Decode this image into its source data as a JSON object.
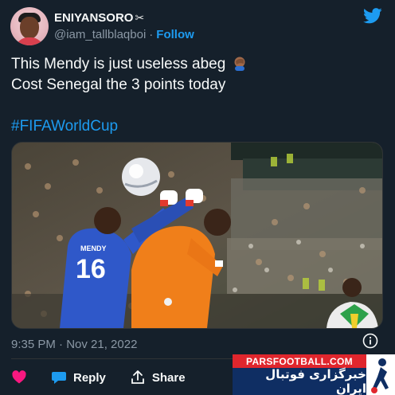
{
  "author": {
    "display_name": "ENIYANSORO",
    "handle": "@iam_tallblaqboi",
    "separator": "·",
    "follow_label": "Follow"
  },
  "tweet": {
    "line1": "This Mendy is just useless abeg",
    "line2": "Cost Senegal the 3 points today",
    "hashtag": "#FIFAWorldCup"
  },
  "media": {
    "jersey_name": "MENDY",
    "jersey_number": "16"
  },
  "meta": {
    "timestamp": "9:35 PM · Nov 21, 2022"
  },
  "actions": {
    "reply_label": "Reply",
    "share_label": "Share"
  },
  "watermark": {
    "site": "PARSFOOTBALL.COM",
    "persian_text": "خبرگزاری فوتبال ایران"
  },
  "colors": {
    "background": "#15202b",
    "link": "#1d9bf0",
    "secondary_text": "#8b98a5",
    "like": "#f91880"
  },
  "icons": {
    "twitter": "twitter-bird-icon",
    "like": "heart-icon",
    "reply": "speech-bubble-icon",
    "share": "share-arrow-icon",
    "info": "info-icon",
    "emoji": "facepalm-emoji"
  }
}
